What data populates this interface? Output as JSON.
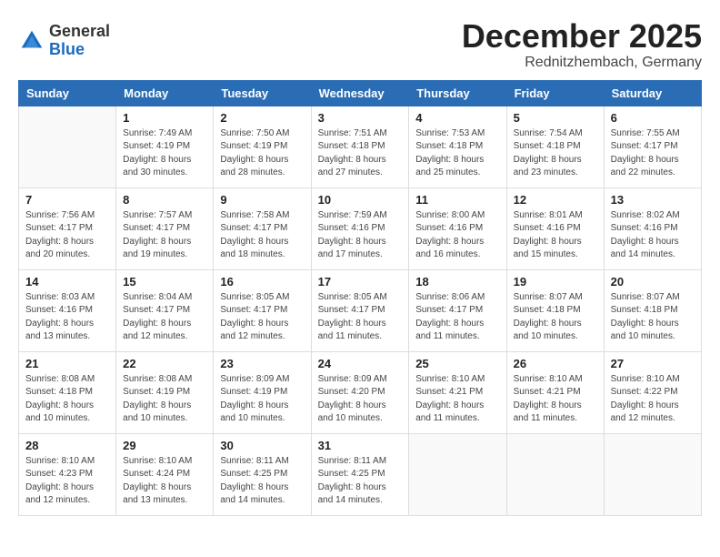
{
  "header": {
    "logo": {
      "line1": "General",
      "line2": "Blue"
    },
    "title": "December 2025",
    "location": "Rednitzhembach, Germany"
  },
  "weekdays": [
    "Sunday",
    "Monday",
    "Tuesday",
    "Wednesday",
    "Thursday",
    "Friday",
    "Saturday"
  ],
  "weeks": [
    [
      {
        "day": "",
        "info": ""
      },
      {
        "day": "1",
        "info": "Sunrise: 7:49 AM\nSunset: 4:19 PM\nDaylight: 8 hours\nand 30 minutes."
      },
      {
        "day": "2",
        "info": "Sunrise: 7:50 AM\nSunset: 4:19 PM\nDaylight: 8 hours\nand 28 minutes."
      },
      {
        "day": "3",
        "info": "Sunrise: 7:51 AM\nSunset: 4:18 PM\nDaylight: 8 hours\nand 27 minutes."
      },
      {
        "day": "4",
        "info": "Sunrise: 7:53 AM\nSunset: 4:18 PM\nDaylight: 8 hours\nand 25 minutes."
      },
      {
        "day": "5",
        "info": "Sunrise: 7:54 AM\nSunset: 4:18 PM\nDaylight: 8 hours\nand 23 minutes."
      },
      {
        "day": "6",
        "info": "Sunrise: 7:55 AM\nSunset: 4:17 PM\nDaylight: 8 hours\nand 22 minutes."
      }
    ],
    [
      {
        "day": "7",
        "info": "Sunrise: 7:56 AM\nSunset: 4:17 PM\nDaylight: 8 hours\nand 20 minutes."
      },
      {
        "day": "8",
        "info": "Sunrise: 7:57 AM\nSunset: 4:17 PM\nDaylight: 8 hours\nand 19 minutes."
      },
      {
        "day": "9",
        "info": "Sunrise: 7:58 AM\nSunset: 4:17 PM\nDaylight: 8 hours\nand 18 minutes."
      },
      {
        "day": "10",
        "info": "Sunrise: 7:59 AM\nSunset: 4:16 PM\nDaylight: 8 hours\nand 17 minutes."
      },
      {
        "day": "11",
        "info": "Sunrise: 8:00 AM\nSunset: 4:16 PM\nDaylight: 8 hours\nand 16 minutes."
      },
      {
        "day": "12",
        "info": "Sunrise: 8:01 AM\nSunset: 4:16 PM\nDaylight: 8 hours\nand 15 minutes."
      },
      {
        "day": "13",
        "info": "Sunrise: 8:02 AM\nSunset: 4:16 PM\nDaylight: 8 hours\nand 14 minutes."
      }
    ],
    [
      {
        "day": "14",
        "info": "Sunrise: 8:03 AM\nSunset: 4:16 PM\nDaylight: 8 hours\nand 13 minutes."
      },
      {
        "day": "15",
        "info": "Sunrise: 8:04 AM\nSunset: 4:17 PM\nDaylight: 8 hours\nand 12 minutes."
      },
      {
        "day": "16",
        "info": "Sunrise: 8:05 AM\nSunset: 4:17 PM\nDaylight: 8 hours\nand 12 minutes."
      },
      {
        "day": "17",
        "info": "Sunrise: 8:05 AM\nSunset: 4:17 PM\nDaylight: 8 hours\nand 11 minutes."
      },
      {
        "day": "18",
        "info": "Sunrise: 8:06 AM\nSunset: 4:17 PM\nDaylight: 8 hours\nand 11 minutes."
      },
      {
        "day": "19",
        "info": "Sunrise: 8:07 AM\nSunset: 4:18 PM\nDaylight: 8 hours\nand 10 minutes."
      },
      {
        "day": "20",
        "info": "Sunrise: 8:07 AM\nSunset: 4:18 PM\nDaylight: 8 hours\nand 10 minutes."
      }
    ],
    [
      {
        "day": "21",
        "info": "Sunrise: 8:08 AM\nSunset: 4:18 PM\nDaylight: 8 hours\nand 10 minutes."
      },
      {
        "day": "22",
        "info": "Sunrise: 8:08 AM\nSunset: 4:19 PM\nDaylight: 8 hours\nand 10 minutes."
      },
      {
        "day": "23",
        "info": "Sunrise: 8:09 AM\nSunset: 4:19 PM\nDaylight: 8 hours\nand 10 minutes."
      },
      {
        "day": "24",
        "info": "Sunrise: 8:09 AM\nSunset: 4:20 PM\nDaylight: 8 hours\nand 10 minutes."
      },
      {
        "day": "25",
        "info": "Sunrise: 8:10 AM\nSunset: 4:21 PM\nDaylight: 8 hours\nand 11 minutes."
      },
      {
        "day": "26",
        "info": "Sunrise: 8:10 AM\nSunset: 4:21 PM\nDaylight: 8 hours\nand 11 minutes."
      },
      {
        "day": "27",
        "info": "Sunrise: 8:10 AM\nSunset: 4:22 PM\nDaylight: 8 hours\nand 12 minutes."
      }
    ],
    [
      {
        "day": "28",
        "info": "Sunrise: 8:10 AM\nSunset: 4:23 PM\nDaylight: 8 hours\nand 12 minutes."
      },
      {
        "day": "29",
        "info": "Sunrise: 8:10 AM\nSunset: 4:24 PM\nDaylight: 8 hours\nand 13 minutes."
      },
      {
        "day": "30",
        "info": "Sunrise: 8:11 AM\nSunset: 4:25 PM\nDaylight: 8 hours\nand 14 minutes."
      },
      {
        "day": "31",
        "info": "Sunrise: 8:11 AM\nSunset: 4:25 PM\nDaylight: 8 hours\nand 14 minutes."
      },
      {
        "day": "",
        "info": ""
      },
      {
        "day": "",
        "info": ""
      },
      {
        "day": "",
        "info": ""
      }
    ]
  ]
}
